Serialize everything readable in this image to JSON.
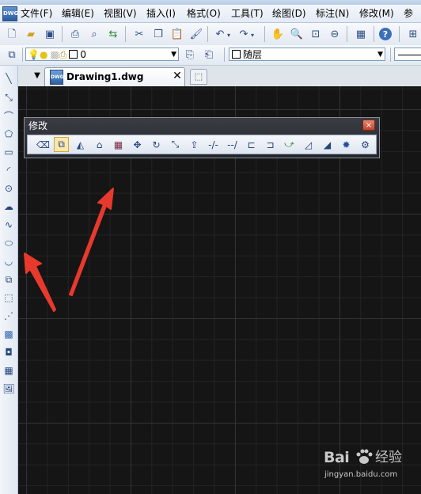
{
  "app": {
    "icon_text": "DWG"
  },
  "menu": [
    "文件(F)",
    "编辑(E)",
    "视图(V)",
    "插入(I)",
    "格式(O)",
    "工具(T)",
    "绘图(D)",
    "标注(N)",
    "修改(M)",
    "参"
  ],
  "toolbar_top": {
    "icons": [
      "new-icon",
      "open-icon",
      "save-icon",
      "print-icon",
      "print-preview-icon",
      "publish-icon",
      "cut-icon",
      "copy-icon",
      "paste-icon",
      "match-properties-icon",
      "undo-icon",
      "redo-icon",
      "pan-icon",
      "zoom-realtime-icon",
      "zoom-window-icon",
      "zoom-previous-icon",
      "calculator-icon",
      "help-icon"
    ]
  },
  "layer_bar": {
    "layer_value": "0",
    "linetype_value": "随层"
  },
  "tabs": {
    "active_label": "Drawing1.dwg",
    "close_glyph": "✕"
  },
  "modify_panel": {
    "title": "修改",
    "close_glyph": "×",
    "tools": [
      "erase-icon",
      "copy-object-icon",
      "mirror-icon",
      "offset-icon",
      "array-icon",
      "move-icon",
      "rotate-icon",
      "scale-icon",
      "stretch-icon",
      "trim-icon",
      "extend-icon",
      "break-at-point-icon",
      "break-icon",
      "join-icon",
      "chamfer-icon",
      "fillet-icon",
      "fillet-curve-icon",
      "explode-icon",
      "modify-properties-icon"
    ],
    "selected_index": 1
  },
  "draw_toolbar": {
    "tools": [
      "line-icon",
      "construction-line-icon",
      "polyline-icon",
      "polygon-icon",
      "rectangle-icon",
      "arc-icon",
      "circle-icon",
      "revision-cloud-icon",
      "spline-icon",
      "ellipse-icon",
      "ellipse-arc-icon",
      "insert-block-icon",
      "make-block-icon",
      "point-icon",
      "hatch-icon",
      "region-icon",
      "table-icon",
      "image-icon"
    ]
  },
  "watermark": {
    "brand": "Bai",
    "brand_suffix": "经验",
    "url": "jingyan.baidu.com"
  },
  "colors": {
    "canvas": "#151515",
    "annotation_arrow": "#e8392d",
    "accent": "#2e5f9f"
  }
}
